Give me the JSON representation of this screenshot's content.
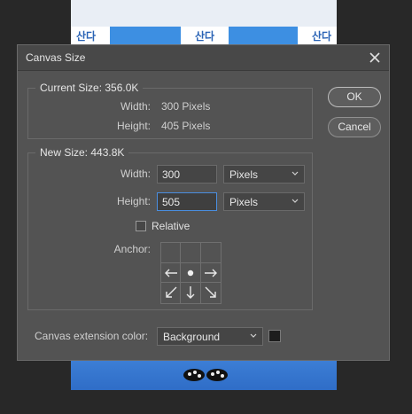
{
  "background": {
    "banner_text": "산다"
  },
  "dialog": {
    "title": "Canvas Size",
    "ok_label": "OK",
    "cancel_label": "Cancel",
    "current": {
      "title": "Current Size: 356.0K",
      "width_label": "Width:",
      "width_value": "300 Pixels",
      "height_label": "Height:",
      "height_value": "405 Pixels"
    },
    "new": {
      "title": "New Size: 443.8K",
      "width_label": "Width:",
      "width_value": "300",
      "width_unit": "Pixels",
      "height_label": "Height:",
      "height_value": "505",
      "height_unit": "Pixels",
      "relative_label": "Relative",
      "relative_checked": false,
      "anchor_label": "Anchor:"
    },
    "extension": {
      "label": "Canvas extension color:",
      "value": "Background",
      "swatch_color": "#1d1d1d"
    }
  },
  "colors": {
    "dialog_bg": "#535353",
    "focus_border": "#4a8ee0"
  }
}
